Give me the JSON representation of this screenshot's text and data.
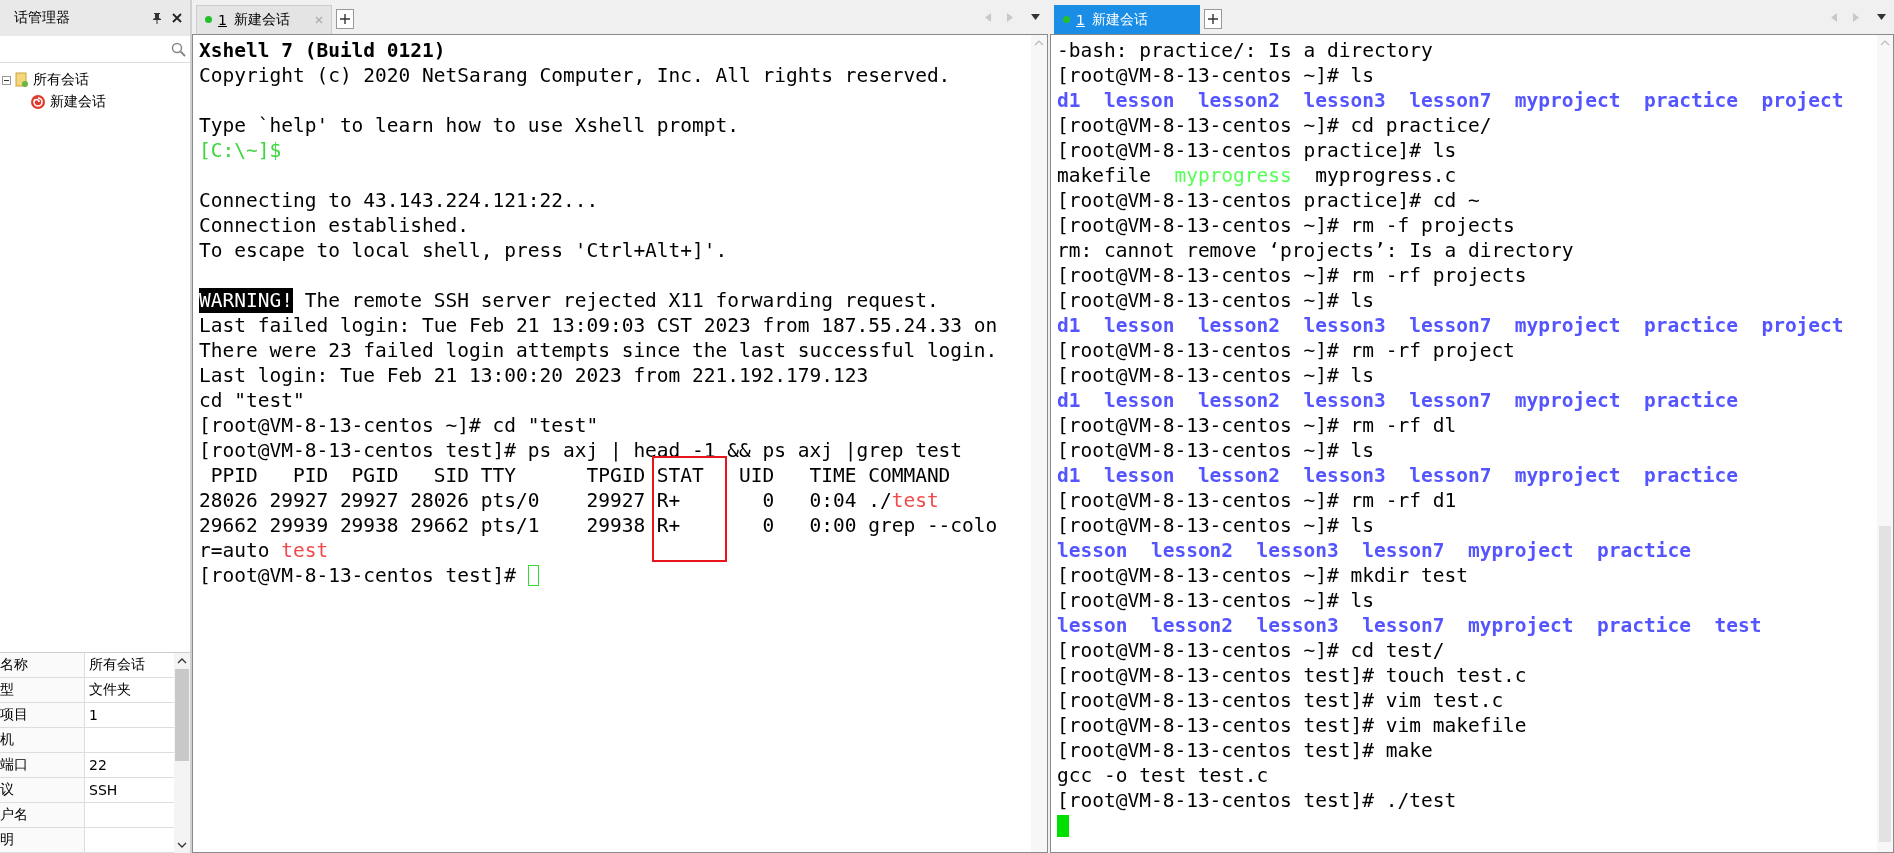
{
  "sidebar": {
    "title": "话管理器",
    "tree": [
      {
        "label": "所有会话",
        "expanded": true,
        "children": [
          {
            "label": "新建会话"
          }
        ]
      }
    ],
    "properties": [
      {
        "name": "名称",
        "value": "所有会话"
      },
      {
        "name": "型",
        "value": "文件夹"
      },
      {
        "name": "项目",
        "value": "1"
      },
      {
        "name": "机"
      },
      {
        "name": "端口",
        "value": "22"
      },
      {
        "name": "议",
        "value": "SSH"
      },
      {
        "name": "户名"
      },
      {
        "name": "明"
      }
    ]
  },
  "panes": [
    {
      "tabs": [
        {
          "number": "1",
          "label": "新建会话",
          "selected": false
        }
      ],
      "stat_box": true,
      "lines": [
        {
          "kind": "text",
          "segments": [
            {
              "text": "Xshell 7 (Build 0121)",
              "kind": "bold"
            }
          ]
        },
        {
          "kind": "text",
          "segments": [
            {
              "text": "Copyright (c) 2020 NetSarang Computer, Inc. All rights reserved.",
              "kind": "plain"
            }
          ]
        },
        {
          "kind": "blank"
        },
        {
          "kind": "text",
          "segments": [
            {
              "text": "Type `help' to learn how to use Xshell prompt.",
              "kind": "plain"
            }
          ]
        },
        {
          "kind": "text",
          "segments": [
            {
              "text": "[C:\\~]$",
              "kind": "green"
            }
          ]
        },
        {
          "kind": "blank"
        },
        {
          "kind": "text",
          "segments": [
            {
              "text": "Connecting to 43.143.224.121:22...",
              "kind": "plain"
            }
          ]
        },
        {
          "kind": "text",
          "segments": [
            {
              "text": "Connection established.",
              "kind": "plain"
            }
          ]
        },
        {
          "kind": "text",
          "segments": [
            {
              "text": "To escape to local shell, press 'Ctrl+Alt+]'.",
              "kind": "plain"
            }
          ]
        },
        {
          "kind": "blank"
        },
        {
          "kind": "text",
          "segments": [
            {
              "text": "WARNING!",
              "kind": "inverse"
            },
            {
              "text": " The remote SSH server rejected X11 forwarding request.",
              "kind": "plain"
            }
          ]
        },
        {
          "kind": "text",
          "segments": [
            {
              "text": "Last failed login: Tue Feb 21 13:09:03 CST 2023 from 187.55.24.33 on",
              "kind": "plain"
            }
          ]
        },
        {
          "kind": "text",
          "segments": [
            {
              "text": "There were 23 failed login attempts since the last successful login.",
              "kind": "plain"
            }
          ]
        },
        {
          "kind": "text",
          "segments": [
            {
              "text": "Last login: Tue Feb 21 13:00:20 2023 from 221.192.179.123",
              "kind": "plain"
            }
          ]
        },
        {
          "kind": "text",
          "segments": [
            {
              "text": "cd \"test\"",
              "kind": "plain"
            }
          ]
        },
        {
          "kind": "text",
          "segments": [
            {
              "text": "[root@VM-8-13-centos ~]# cd \"test\"",
              "kind": "plain"
            }
          ]
        },
        {
          "kind": "text",
          "segments": [
            {
              "text": "[root@VM-8-13-centos test]# ps axj | head -1 && ps axj |grep test",
              "kind": "plain"
            }
          ]
        },
        {
          "kind": "text",
          "segments": [
            {
              "text": " PPID   PID  PGID   SID TTY      TPGID STAT   UID   TIME COMMAND",
              "kind": "plain"
            }
          ]
        },
        {
          "kind": "text",
          "segments": [
            {
              "text": "28026 29927 29927 28026 pts/0    29927 R+       0   0:04 ./",
              "kind": "plain"
            },
            {
              "text": "test",
              "kind": "red"
            }
          ]
        },
        {
          "kind": "text",
          "segments": [
            {
              "text": "29662 29939 29938 29662 pts/1    29938 R+       0   0:00 grep --colo",
              "kind": "plain"
            }
          ]
        },
        {
          "kind": "text",
          "segments": [
            {
              "text": "r=auto ",
              "kind": "plain"
            },
            {
              "text": "test",
              "kind": "red"
            }
          ]
        },
        {
          "kind": "text",
          "segments": [
            {
              "text": "[root@VM-8-13-centos test]# ",
              "kind": "plain"
            },
            {
              "kind": "cursor-outline"
            }
          ]
        }
      ]
    },
    {
      "tabs": [
        {
          "number": "1",
          "label": "新建会话",
          "selected": true
        }
      ],
      "lines": [
        {
          "kind": "text",
          "segments": [
            {
              "text": "-bash: practice/: Is a directory",
              "kind": "plain"
            }
          ]
        },
        {
          "kind": "text",
          "segments": [
            {
              "text": "[root@VM-8-13-centos ~]# ls",
              "kind": "plain"
            }
          ]
        },
        {
          "kind": "text",
          "segments": [
            {
              "text": "d1  lesson  lesson2  lesson3  lesson7  myproject  practice  project",
              "kind": "blue"
            }
          ]
        },
        {
          "kind": "text",
          "segments": [
            {
              "text": "[root@VM-8-13-centos ~]# cd practice/",
              "kind": "plain"
            }
          ]
        },
        {
          "kind": "text",
          "segments": [
            {
              "text": "[root@VM-8-13-centos practice]# ls",
              "kind": "plain"
            }
          ]
        },
        {
          "kind": "text",
          "segments": [
            {
              "text": "makefile  ",
              "kind": "plain"
            },
            {
              "text": "myprogress",
              "kind": "lime"
            },
            {
              "text": "  myprogress.c",
              "kind": "plain"
            }
          ]
        },
        {
          "kind": "text",
          "segments": [
            {
              "text": "[root@VM-8-13-centos practice]# cd ~",
              "kind": "plain"
            }
          ]
        },
        {
          "kind": "text",
          "segments": [
            {
              "text": "[root@VM-8-13-centos ~]# rm -f projects",
              "kind": "plain"
            }
          ]
        },
        {
          "kind": "text",
          "segments": [
            {
              "text": "rm: cannot remove ‘projects’: Is a directory",
              "kind": "plain"
            }
          ]
        },
        {
          "kind": "text",
          "segments": [
            {
              "text": "[root@VM-8-13-centos ~]# rm -rf projects",
              "kind": "plain"
            }
          ]
        },
        {
          "kind": "text",
          "segments": [
            {
              "text": "[root@VM-8-13-centos ~]# ls",
              "kind": "plain"
            }
          ]
        },
        {
          "kind": "text",
          "segments": [
            {
              "text": "d1  lesson  lesson2  lesson3  lesson7  myproject  practice  project",
              "kind": "blue"
            }
          ]
        },
        {
          "kind": "text",
          "segments": [
            {
              "text": "[root@VM-8-13-centos ~]# rm -rf project",
              "kind": "plain"
            }
          ]
        },
        {
          "kind": "text",
          "segments": [
            {
              "text": "[root@VM-8-13-centos ~]# ls",
              "kind": "plain"
            }
          ]
        },
        {
          "kind": "text",
          "segments": [
            {
              "text": "d1  lesson  lesson2  lesson3  lesson7  myproject  practice",
              "kind": "blue"
            }
          ]
        },
        {
          "kind": "text",
          "segments": [
            {
              "text": "[root@VM-8-13-centos ~]# rm -rf dl",
              "kind": "plain"
            }
          ]
        },
        {
          "kind": "text",
          "segments": [
            {
              "text": "[root@VM-8-13-centos ~]# ls",
              "kind": "plain"
            }
          ]
        },
        {
          "kind": "text",
          "segments": [
            {
              "text": "d1  lesson  lesson2  lesson3  lesson7  myproject  practice",
              "kind": "blue"
            }
          ]
        },
        {
          "kind": "text",
          "segments": [
            {
              "text": "[root@VM-8-13-centos ~]# rm -rf d1",
              "kind": "plain"
            }
          ]
        },
        {
          "kind": "text",
          "segments": [
            {
              "text": "[root@VM-8-13-centos ~]# ls",
              "kind": "plain"
            }
          ]
        },
        {
          "kind": "text",
          "segments": [
            {
              "text": "lesson  lesson2  lesson3  lesson7  myproject  practice",
              "kind": "blue"
            }
          ]
        },
        {
          "kind": "text",
          "segments": [
            {
              "text": "[root@VM-8-13-centos ~]# mkdir test",
              "kind": "plain"
            }
          ]
        },
        {
          "kind": "text",
          "segments": [
            {
              "text": "[root@VM-8-13-centos ~]# ls",
              "kind": "plain"
            }
          ]
        },
        {
          "kind": "text",
          "segments": [
            {
              "text": "lesson  lesson2  lesson3  lesson7  myproject  practice  test",
              "kind": "blue"
            }
          ]
        },
        {
          "kind": "text",
          "segments": [
            {
              "text": "[root@VM-8-13-centos ~]# cd test/",
              "kind": "plain"
            }
          ]
        },
        {
          "kind": "text",
          "segments": [
            {
              "text": "[root@VM-8-13-centos test]# touch test.c",
              "kind": "plain"
            }
          ]
        },
        {
          "kind": "text",
          "segments": [
            {
              "text": "[root@VM-8-13-centos test]# vim test.c",
              "kind": "plain"
            }
          ]
        },
        {
          "kind": "text",
          "segments": [
            {
              "text": "[root@VM-8-13-centos test]# vim makefile",
              "kind": "plain"
            }
          ]
        },
        {
          "kind": "text",
          "segments": [
            {
              "text": "[root@VM-8-13-centos test]# make",
              "kind": "plain"
            }
          ]
        },
        {
          "kind": "text",
          "segments": [
            {
              "text": "gcc -o test test.c",
              "kind": "plain"
            }
          ]
        },
        {
          "kind": "text",
          "segments": [
            {
              "text": "[root@VM-8-13-centos test]# ./test",
              "kind": "plain"
            }
          ]
        },
        {
          "kind": "text",
          "segments": [
            {
              "kind": "cursor-block"
            }
          ]
        }
      ]
    }
  ]
}
